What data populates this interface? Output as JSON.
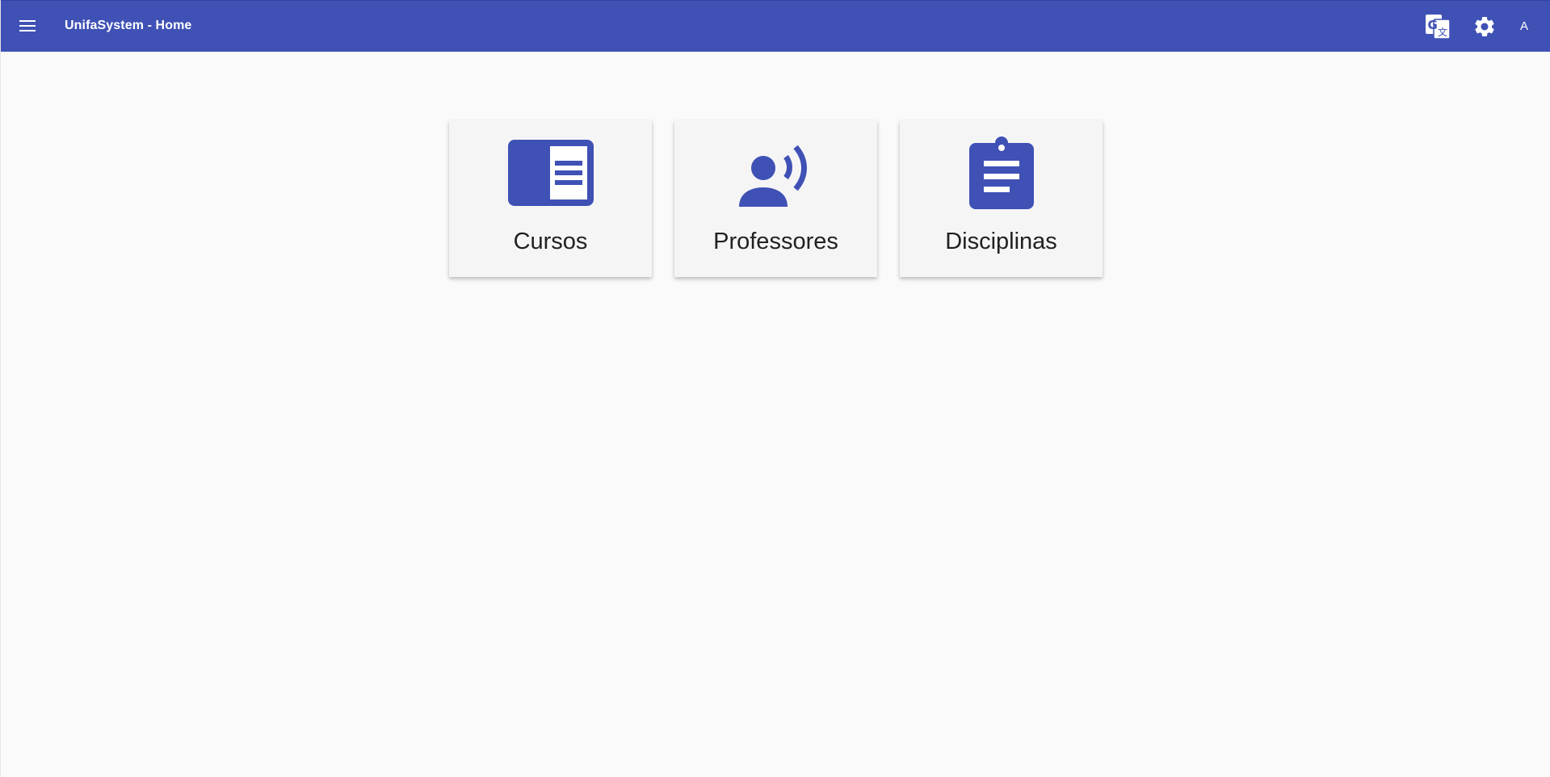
{
  "toolbar": {
    "title": "UnifaSystem - Home",
    "menu_icon": "menu-icon",
    "translate_icon": "translate-icon",
    "settings_icon": "settings-icon",
    "avatar_letter": "A"
  },
  "cards": [
    {
      "label": "Cursos",
      "icon": "chrome-reader-mode-icon"
    },
    {
      "label": "Professores",
      "icon": "record-voice-over-icon"
    },
    {
      "label": "Disciplinas",
      "icon": "assignment-icon"
    }
  ],
  "colors": {
    "primary": "#3f51b5",
    "background": "#fafafa",
    "card": "#f5f5f5",
    "text": "#212121"
  }
}
